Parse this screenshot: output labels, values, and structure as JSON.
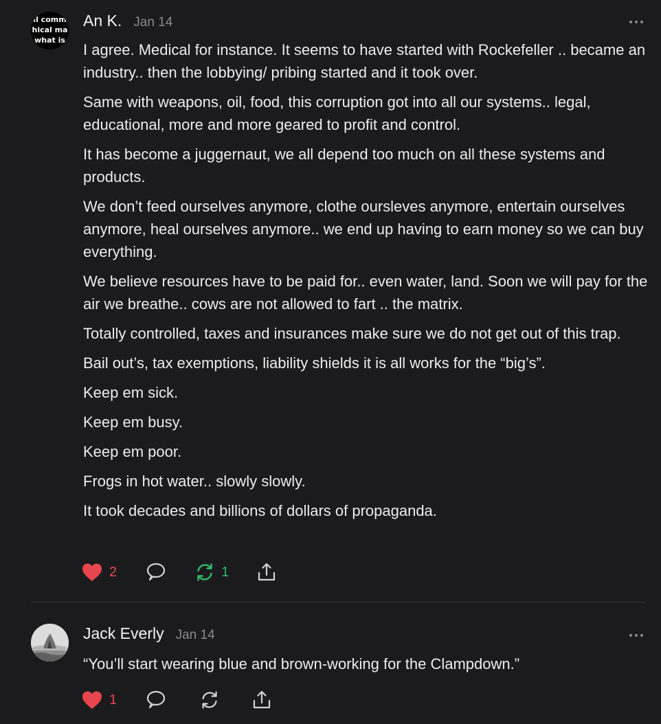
{
  "comments": [
    {
      "author": "An K.",
      "date": "Jan 14",
      "avatar_text": [
        "ll comm",
        "hical ma",
        "what is"
      ],
      "paragraphs": [
        "I agree. Medical for instance. It seems to have started with Rockefeller .. became an industry.. then the lobbying/ pribing started and it took over.",
        "Same with weapons, oil, food, this corruption got into all our systems.. legal, educational, more and more geared to profit and control.",
        "It has become a juggernaut, we all depend too much on all these systems and products.",
        "We don’t feed ourselves anymore, clothe oursleves anymore, entertain ourselves anymore, heal ourselves anymore.. we end up having to earn money so we can buy everything.",
        "We believe resources have to be paid for.. even water, land. Soon we will pay for the air we breathe.. cows are not allowed to fart .. the matrix.",
        "Totally controlled, taxes and insurances make sure we do not get out of this trap.",
        "Bail out’s, tax exemptions, liability shields it is all works for the “big’s”.",
        "Keep em sick.",
        "Keep em busy.",
        "Keep em poor.",
        "Frogs in hot water.. slowly slowly.",
        "It took decades and billions of dollars of propaganda."
      ],
      "likes": "2",
      "restacks": "1",
      "liked": true,
      "restacked": true
    },
    {
      "author": "Jack Everly",
      "date": "Jan 14",
      "paragraphs": [
        "“You’ll start wearing blue and brown-working for the Clampdown.”"
      ],
      "likes": "1",
      "restacks": "",
      "liked": true,
      "restacked": false
    }
  ],
  "icons": {
    "like": "heart-icon",
    "reply": "comment-bubble-icon",
    "restack": "restack-arrows-icon",
    "share": "share-icon",
    "more": "more-dots-icon"
  },
  "colors": {
    "background": "#1b1b1d",
    "liked": "#e8464e",
    "restacked": "#2ebd6b",
    "muted": "#8a8a8e"
  }
}
